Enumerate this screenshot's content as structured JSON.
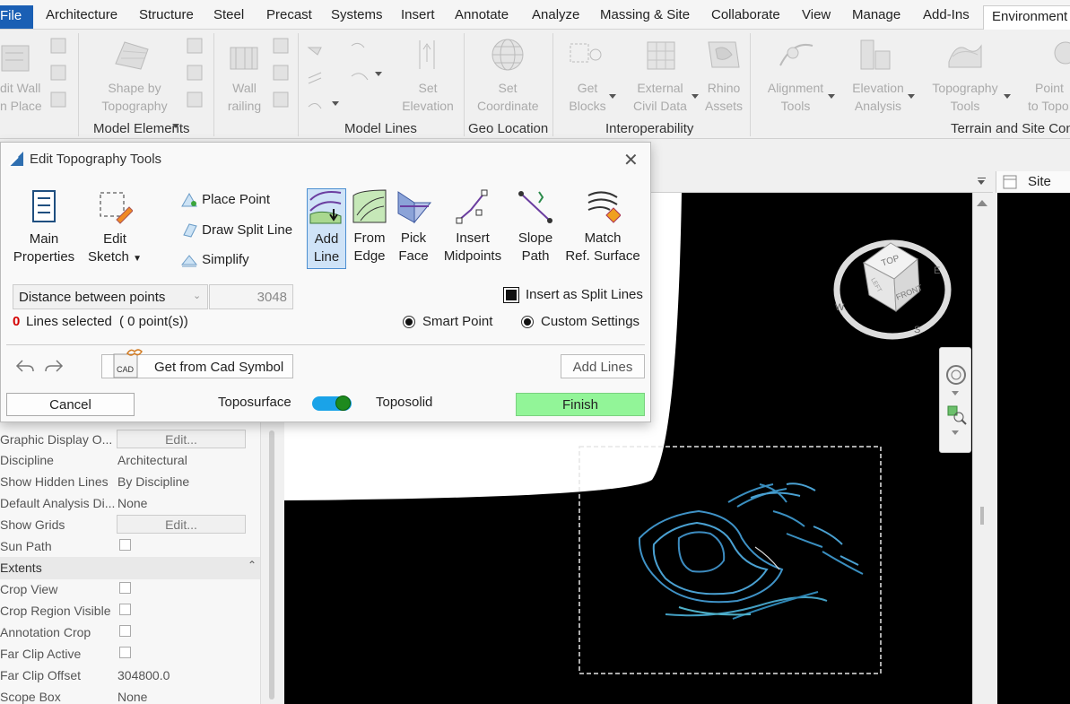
{
  "menu": {
    "file": "File",
    "tabs": [
      "Architecture",
      "Structure",
      "Steel",
      "Precast",
      "Systems",
      "Insert",
      "Annotate",
      "Analyze",
      "Massing & Site",
      "Collaborate",
      "View",
      "Manage",
      "Add-Ins"
    ],
    "active_tab": "Environment"
  },
  "ribbon": {
    "edit_wall": [
      "dit Wall",
      "n Place"
    ],
    "shape_by_topo": [
      "Shape by",
      "Topography"
    ],
    "wall_railing": [
      "Wall",
      "railing"
    ],
    "set_elevation": [
      "Set",
      "Elevation"
    ],
    "set_coordinate": [
      "Set",
      "Coordinate"
    ],
    "get_blocks": [
      "Get",
      "Blocks"
    ],
    "external_civil": [
      "External",
      "Civil Data"
    ],
    "rhino_assets": [
      "Rhino",
      "Assets"
    ],
    "alignment_tools": [
      "Alignment",
      "Tools"
    ],
    "elevation_analysis": [
      "Elevation",
      "Analysis"
    ],
    "topography_tools": [
      "Topography",
      "Tools"
    ],
    "point_to_topo": [
      "Point",
      "to Topo"
    ],
    "groups": {
      "model_elements": "Model Elements",
      "model_lines": "Model Lines",
      "geo_location": "Geo Location",
      "interoperability": "Interoperability",
      "terrain": "Terrain and Site Con"
    }
  },
  "view": {
    "site_tab": "Site",
    "cube_top": "TOP",
    "cube_front": "FRONT",
    "cube_left": "LEFT",
    "compass_w": "W",
    "compass_e": "E",
    "compass_s": "S"
  },
  "properties": [
    {
      "key": "Graphic Display O...",
      "type": "button",
      "value": "Edit..."
    },
    {
      "key": "Discipline",
      "type": "text",
      "value": "Architectural"
    },
    {
      "key": "Show Hidden Lines",
      "type": "text",
      "value": "By Discipline"
    },
    {
      "key": "Default Analysis Di...",
      "type": "text",
      "value": "None"
    },
    {
      "key": "Show Grids",
      "type": "button",
      "value": "Edit..."
    },
    {
      "key": "Sun Path",
      "type": "check",
      "value": ""
    },
    {
      "key": "Extents",
      "type": "section",
      "value": ""
    },
    {
      "key": "Crop View",
      "type": "check",
      "value": ""
    },
    {
      "key": "Crop Region Visible",
      "type": "check",
      "value": ""
    },
    {
      "key": "Annotation Crop",
      "type": "check",
      "value": ""
    },
    {
      "key": "Far Clip Active",
      "type": "check",
      "value": ""
    },
    {
      "key": "Far Clip Offset",
      "type": "text",
      "value": "304800.0"
    },
    {
      "key": "Scope Box",
      "type": "text",
      "value": "None"
    }
  ],
  "dialog": {
    "title": "Edit Topography Tools",
    "main_properties": [
      "Main",
      "Properties"
    ],
    "edit_sketch": [
      "Edit",
      "Sketch"
    ],
    "place_point": "Place Point",
    "draw_split_line": "Draw Split Line",
    "simplify": "Simplify",
    "add_line": [
      "Add",
      "Line"
    ],
    "from_edge": [
      "From",
      "Edge"
    ],
    "pick_face": [
      "Pick",
      "Face"
    ],
    "insert_midpoints": [
      "Insert",
      "Midpoints"
    ],
    "slope_path": [
      "Slope",
      "Path"
    ],
    "match_ref_surface": [
      "Match",
      "Ref. Surface"
    ],
    "distance_mode": "Distance between points",
    "distance_value": "3048",
    "insert_as_split": "Insert as Split Lines",
    "lines_selected_count": "0",
    "lines_selected_text": "Lines selected",
    "points_text": "( 0 point(s))",
    "smart_point": "Smart Point",
    "custom_settings": "Custom Settings",
    "cad_label": "CAD",
    "get_from_cad": "Get from Cad Symbol",
    "add_lines": "Add Lines",
    "cancel": "Cancel",
    "toposurface": "Toposurface",
    "toposolid": "Toposolid",
    "finish": "Finish",
    "colors": {
      "accent": "#1aa3e8",
      "finish": "#92f598",
      "count_red": "#d40000"
    }
  }
}
